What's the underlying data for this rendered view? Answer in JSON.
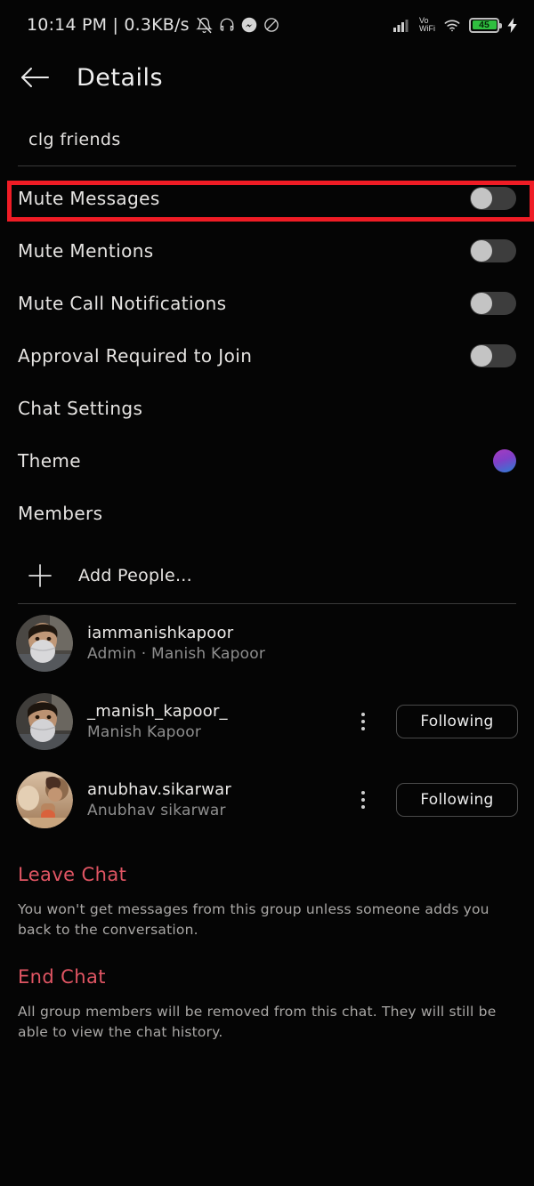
{
  "statusbar": {
    "time_and_data": "10:14 PM | 0.3KB/s",
    "icons_left": [
      "mute-bell-icon",
      "headphones-icon",
      "messenger-icon",
      "do-not-disturb-icon"
    ],
    "signal_icon": "cellular-signal-icon",
    "vo_line1": "Vo",
    "vo_line2": "WiFi",
    "wifi_icon": "wifi-icon",
    "battery_percent": "45",
    "battery_color": "#2fbf3f",
    "charging_icon": "charging-bolt-icon"
  },
  "header": {
    "back_icon": "back-arrow-icon",
    "title": "Details"
  },
  "group": {
    "name": "clg friends"
  },
  "settings": [
    {
      "label": "Mute Messages",
      "control": "toggle",
      "value": "off"
    },
    {
      "label": "Mute Mentions",
      "control": "toggle",
      "value": "off"
    },
    {
      "label": "Mute Call Notifications",
      "control": "toggle",
      "value": "off"
    },
    {
      "label": "Approval Required to Join",
      "control": "toggle",
      "value": "off"
    },
    {
      "label": "Chat Settings",
      "control": "none",
      "value": ""
    },
    {
      "label": "Theme",
      "control": "color-dot",
      "value": ""
    },
    {
      "label": "Members",
      "control": "none",
      "value": ""
    }
  ],
  "theme_colors": {
    "start": "#a83bc0",
    "mid": "#8040c8",
    "end": "#2a7fd4"
  },
  "add_people": {
    "icon": "plus-icon",
    "label": "Add People..."
  },
  "members": [
    {
      "username": "iammanishkapoor",
      "subtitle": "Admin · Manish Kapoor",
      "avatar": "person-masked-portrait",
      "has_menu": false,
      "action_label": ""
    },
    {
      "username": "_manish_kapoor_",
      "subtitle": "Manish Kapoor",
      "avatar": "person-masked-portrait",
      "has_menu": true,
      "action_label": "Following"
    },
    {
      "username": "anubhav.sikarwar",
      "subtitle": "Anubhav sikarwar",
      "avatar": "warm-group-photo",
      "has_menu": true,
      "action_label": "Following"
    }
  ],
  "danger": [
    {
      "title": "Leave Chat",
      "description": "You won't get messages from this group unless someone adds you back to the conversation."
    },
    {
      "title": "End Chat",
      "description": "All group members will be removed from this chat. They will still be able to view the chat history."
    }
  ],
  "annotation": {
    "target": "Mute Messages",
    "color": "#ef1c25"
  }
}
